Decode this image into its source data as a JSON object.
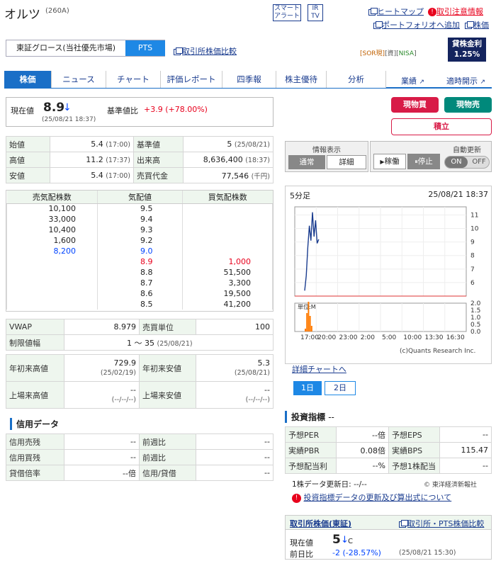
{
  "header": {
    "name": "オルツ",
    "code": "(260A)",
    "smart_alert_1": "スマート",
    "smart_alert_2": "アラート",
    "ir_1": "IR",
    "ir_2": "TV",
    "heatmap": "ヒートマップ",
    "caution": "取引注意情報",
    "portfolio": "ポートフォリオへ追加",
    "kabuka": "株価"
  },
  "market": {
    "exchange": "東証グロース(当社優先市場)",
    "pts": "PTS",
    "compare": "取引所株価比較",
    "sor": "[SOR現]",
    "genbutsu": "[資][",
    "nisa": "NISA",
    "nisa_close": "]",
    "kashi_1": "貸株金利",
    "kashi_2": "1.25%"
  },
  "tabs": [
    "株価",
    "ニュース",
    "チャート",
    "評価レポート",
    "四季報",
    "株主優待",
    "分析"
  ],
  "right_tabs": {
    "gyoseki": "業績",
    "tekiji": "適時開示"
  },
  "price": {
    "label": "現在値",
    "value": "8.9",
    "arrow": "↓",
    "time": "(25/08/21 18:37)",
    "change_label": "基準値比",
    "change": "+3.9",
    "change_pct": "(+78.00%)"
  },
  "buttons": {
    "buy": "現物買",
    "sell": "現物売",
    "tsumitate": "積立"
  },
  "info_panel": {
    "title": "情報表示",
    "normal": "通常",
    "detail": "詳細",
    "running": "稼働",
    "stop": "停止",
    "auto_update": "自動更新",
    "on": "ON",
    "off": "OFF"
  },
  "ohlc": [
    {
      "l1": "始値",
      "v1": "5.4",
      "t1": "(17:00)",
      "l2": "基準値",
      "v2": "5",
      "t2": "(25/08/21)"
    },
    {
      "l1": "高値",
      "v1": "11.2",
      "t1": "(17:37)",
      "l2": "出来高",
      "v2": "8,636,400",
      "t2": "(18:37)"
    },
    {
      "l1": "安値",
      "v1": "5.4",
      "t1": "(17:00)",
      "l2": "売買代金",
      "v2": "77,546",
      "t2": "(千円)"
    }
  ],
  "board": {
    "headers": [
      "売気配株数",
      "気配値",
      "買気配株数"
    ],
    "rows": [
      [
        "10,100",
        "9.5",
        ""
      ],
      [
        "33,000",
        "9.4",
        ""
      ],
      [
        "10,400",
        "9.3",
        ""
      ],
      [
        "1,600",
        "9.2",
        ""
      ],
      [
        "8,200",
        "9.0",
        ""
      ],
      [
        "",
        "8.9",
        "1,000"
      ],
      [
        "",
        "8.8",
        "51,500"
      ],
      [
        "",
        "8.7",
        "3,300"
      ],
      [
        "",
        "8.6",
        "19,500"
      ],
      [
        "",
        "8.5",
        "41,200"
      ]
    ]
  },
  "vwap": {
    "label": "VWAP",
    "value": "8.979",
    "unit_label": "売買単位",
    "unit": "100"
  },
  "limit": {
    "label": "制限値幅",
    "value": "1 〜 35",
    "time": "(25/08/21)"
  },
  "year": {
    "high_label": "年初来高値",
    "high": "729.9",
    "high_date": "(25/02/19)",
    "low_label": "年初来安値",
    "low": "5.3",
    "low_date": "(25/08/21)"
  },
  "listing": {
    "high_label": "上場来高値",
    "high": "--",
    "high_date": "(--/--/--)",
    "low_label": "上場来安値",
    "low": "--",
    "low_date": "(--/--/--)"
  },
  "margin": {
    "title": "信用データ",
    "rows": [
      [
        "信用売残",
        "--",
        "前週比",
        "--"
      ],
      [
        "信用買残",
        "--",
        "前週比",
        "--"
      ],
      [
        "貸借倍率",
        "--倍",
        "信用/貸借",
        "--"
      ]
    ]
  },
  "chart": {
    "interval": "5分足",
    "date": "25/08/21 18:37",
    "y_ticks": [
      "11",
      "10",
      "9",
      "8",
      "7",
      "6"
    ],
    "vol_label": "単位:M",
    "vol_ticks": [
      "2.0",
      "1.5",
      "1.0",
      "0.5",
      "0.0"
    ],
    "x_ticks": [
      "17:00",
      "20:00",
      "23:00",
      "2:00",
      "5:00",
      "10:00",
      "13:30",
      "16:30"
    ],
    "credit": "(c)Quants Research Inc.",
    "detail_link": "詳細チャートへ",
    "d1": "1日",
    "d2": "2日"
  },
  "chart_data": {
    "type": "line",
    "x": [
      "17:00",
      "17:05",
      "17:10",
      "17:15",
      "17:20",
      "17:25",
      "17:30",
      "17:35",
      "17:40",
      "17:45"
    ],
    "y": [
      5.4,
      6.5,
      8.6,
      10.2,
      9.1,
      11.2,
      9.4,
      10.6,
      8.9,
      9.2
    ],
    "ylim": [
      5,
      11.6
    ],
    "volume": [
      0.2,
      1.3,
      2.1,
      1.1,
      0.4
    ],
    "volume_ylim": [
      0,
      2.0
    ],
    "base": 5
  },
  "indicators": {
    "title": "投資指標",
    "dash": "--",
    "rows": [
      [
        "予想PER",
        "--倍",
        "予想EPS",
        "--"
      ],
      [
        "実績PBR",
        "0.08倍",
        "実績BPS",
        "115.47"
      ],
      [
        "予想配当利",
        "--%",
        "予想1株配当",
        "--"
      ]
    ],
    "update": "1株データ更新日:",
    "update_val": "--/--",
    "source": "© 東洋経済新報社",
    "notice": "投資指標データの更新及び算出式について"
  },
  "exchange_price": {
    "title": "取引所株価(東証)",
    "link": "取引所・PTS株価比較",
    "label": "現在値",
    "value": "5",
    "arrow": "↓",
    "c": "C",
    "prev_label": "前日比",
    "change": "-2",
    "pct": "(-28.57%)",
    "time": "(25/08/21 15:30)"
  }
}
